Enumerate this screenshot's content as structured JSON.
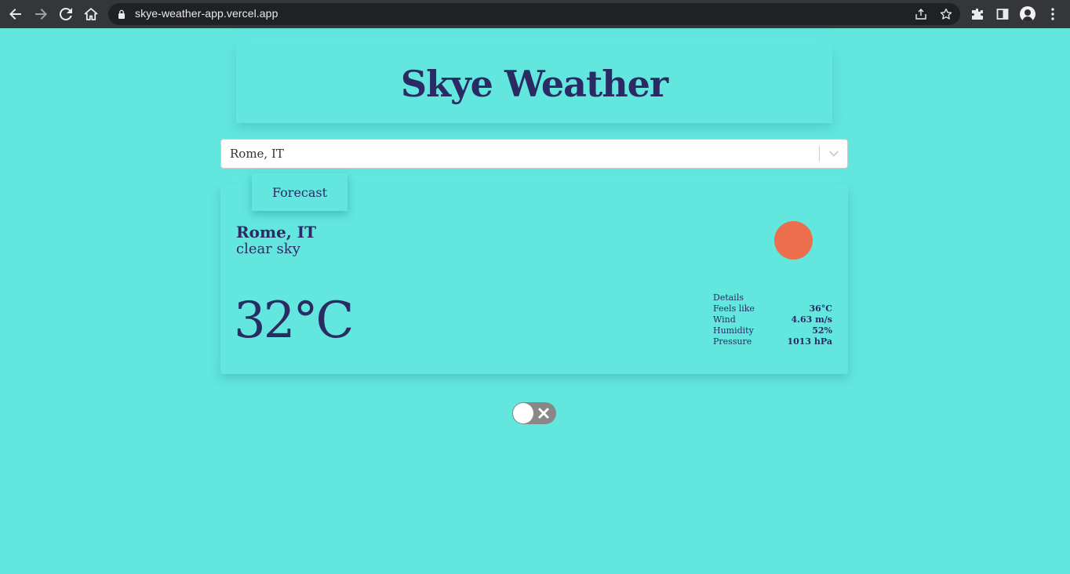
{
  "browser": {
    "url": "skye-weather-app.vercel.app"
  },
  "app": {
    "title": "Skye Weather",
    "search": {
      "value": "Rome, IT"
    },
    "tab_label": "Forecast",
    "current": {
      "city": "Rome, IT",
      "description": "clear sky",
      "temperature": "32°C",
      "details_title": "Details",
      "details": [
        {
          "label": "Feels like",
          "value": "36°C"
        },
        {
          "label": "Wind",
          "value": "4.63 m/s"
        },
        {
          "label": "Humidity",
          "value": "52%"
        },
        {
          "label": "Pressure",
          "value": "1013 hPa"
        }
      ]
    },
    "toggle": {
      "state": "off"
    }
  },
  "colors": {
    "background": "#62e6de",
    "text": "#2a2b63",
    "sun": "#ec6e4c",
    "chrome": "#35363a"
  }
}
